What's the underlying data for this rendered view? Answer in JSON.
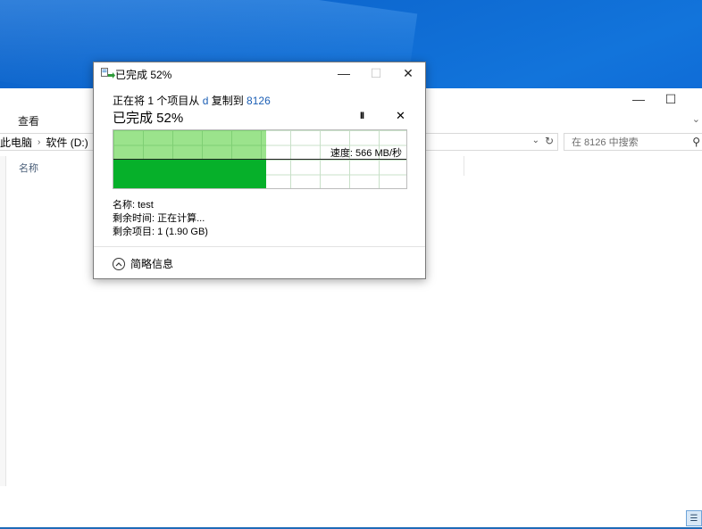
{
  "explorer": {
    "ribbon_tab": "查看",
    "breadcrumb": [
      "此电脑",
      "软件 (D:)"
    ],
    "search_placeholder": "在 8126 中搜索",
    "column_name": "名称"
  },
  "dialog": {
    "title": "已完成 52%",
    "copy_prefix": "正在将 1 个项目从 ",
    "source": "d",
    "copy_middle": " 复制到 ",
    "destination": "8126",
    "progress_title": "已完成 52%",
    "progress_percent": 52,
    "speed_label": "速度: 566 MB/秒",
    "name_line": "名称: test",
    "time_left_line": "剩余时间: 正在计算...",
    "items_left_line": "剩余项目: 1 (1.90 GB)",
    "less_info": "简略信息",
    "pause_symbol": "II",
    "close_symbol": "✕",
    "min_symbol": "—",
    "max_symbol": "☐"
  },
  "colors": {
    "graph_light": "#9be38c",
    "graph_dark": "#06b02a",
    "link": "#1c5fb5"
  }
}
